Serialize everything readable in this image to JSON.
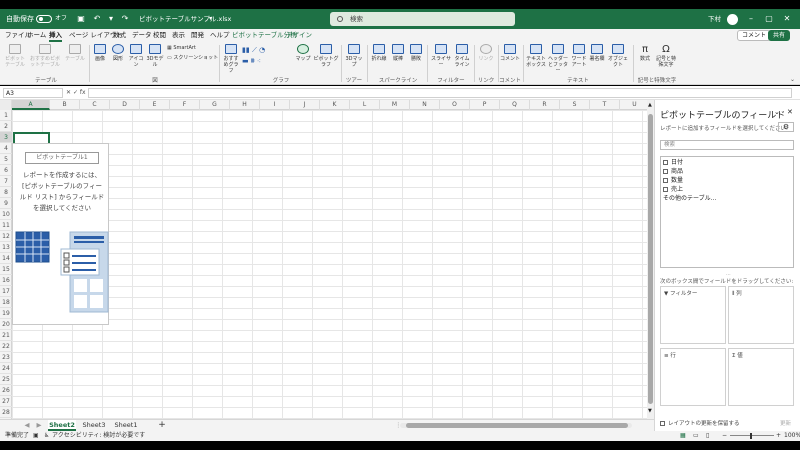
{
  "titlebar": {
    "autosave_label": "自動保存",
    "toggle_state": "オフ",
    "filename": "ピボットテーブルサンプル.xlsx",
    "search_placeholder": "検索",
    "user_name": "下村"
  },
  "menu": {
    "tabs": [
      "ファイル",
      "ホーム",
      "挿入",
      "ページ レイアウト",
      "数式",
      "データ",
      "校閲",
      "表示",
      "開発",
      "ヘルプ"
    ],
    "active_tab": "挿入",
    "context_tabs": [
      "ピボットテーブル分析",
      "デザイン"
    ],
    "comment_button": "コメント",
    "share_button": "共有"
  },
  "ribbon": {
    "groups": [
      {
        "label": "テーブル",
        "buttons": [
          "ピボットテーブル",
          "おすすめピボットテーブル",
          "テーブル"
        ]
      },
      {
        "label": "図",
        "buttons": [
          "画像",
          "図形",
          "アイコン",
          "3Dモデル",
          "SmartArt",
          "スクリーンショット"
        ]
      },
      {
        "label": "グラフ",
        "buttons": [
          "おすすめグラフ",
          "マップ",
          "ピボットグラフ"
        ]
      },
      {
        "label": "ツアー",
        "buttons": [
          "3Dマップ"
        ]
      },
      {
        "label": "スパークライン",
        "buttons": [
          "折れ線",
          "縦棒",
          "勝敗"
        ]
      },
      {
        "label": "フィルター",
        "buttons": [
          "スライサー",
          "タイムライン"
        ]
      },
      {
        "label": "リンク",
        "buttons": [
          "リンク"
        ]
      },
      {
        "label": "コメント",
        "buttons": [
          "コメント"
        ]
      },
      {
        "label": "テキスト",
        "buttons": [
          "テキストボックス",
          "ヘッダーとフッター",
          "ワードアート",
          "署名欄",
          "オブジェクト"
        ]
      },
      {
        "label": "記号と特殊文字",
        "buttons": [
          "数式",
          "記号と特殊文字"
        ]
      }
    ]
  },
  "formula_bar": {
    "name_box": "A3",
    "fx": "fx"
  },
  "grid": {
    "columns": [
      "A",
      "B",
      "C",
      "D",
      "E",
      "F",
      "G",
      "H",
      "I",
      "J",
      "K",
      "L",
      "M",
      "N",
      "O",
      "P",
      "Q",
      "R",
      "S",
      "T",
      "U"
    ],
    "rows": [
      "1",
      "2",
      "3",
      "4",
      "5",
      "6",
      "7",
      "8",
      "9",
      "10",
      "11",
      "12",
      "13",
      "14",
      "15",
      "16",
      "17",
      "18",
      "19",
      "20",
      "21",
      "22",
      "23",
      "24",
      "25",
      "26",
      "27",
      "28"
    ],
    "selected_column": "A",
    "selected_row": "3"
  },
  "pivot_placeholder": {
    "title": "ピボットテーブル1",
    "description": "レポートを作成するには、[ピボットテーブルのフィールド リスト] からフィールドを選択してください"
  },
  "sheets": {
    "tabs": [
      "Sheet2",
      "Sheet3",
      "Sheet1"
    ],
    "active": "Sheet2",
    "add": "+"
  },
  "status": {
    "ready": "準備完了",
    "accessibility": "アクセシビリティ: 検討が必要です",
    "zoom": "100%"
  },
  "panel": {
    "title": "ピボットテーブルのフィールド",
    "subtitle": "レポートに追加するフィールドを選択してください:",
    "search_placeholder": "検索",
    "fields": [
      "日付",
      "商品",
      "数量",
      "売上"
    ],
    "more_tables": "その他のテーブル...",
    "drag_hint": "次のボックス間でフィールドをドラッグしてください:",
    "areas": {
      "filter": "フィルター",
      "columns": "列",
      "rows": "行",
      "values": "値"
    },
    "defer_label": "レイアウトの更新を保留する",
    "update_button": "更新"
  }
}
